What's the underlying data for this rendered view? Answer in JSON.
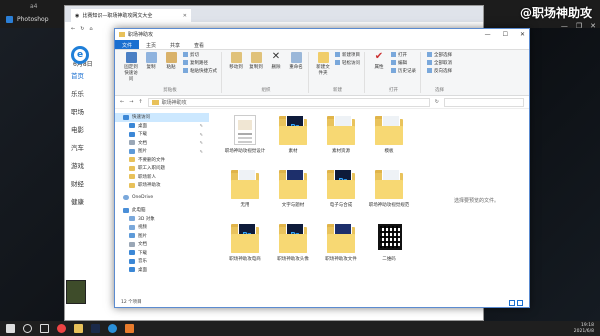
{
  "watermark": "@职场神助攻",
  "photoshop": {
    "tab_label": "Photoshop",
    "top_label": "a4"
  },
  "browser": {
    "tab_title": "比赛知识—职场神助攻网文大全",
    "side_items": [
      "乐乐",
      "职场",
      "电影",
      "汽车",
      "游戏",
      "财经",
      "健康"
    ],
    "home_label": "首页",
    "date": "6月8日"
  },
  "explorer": {
    "title": "职场神助攻",
    "ribbon_tabs": [
      "文件",
      "主页",
      "共享",
      "查看"
    ],
    "ribbon_groups": [
      {
        "name": "剪贴板",
        "buttons": [
          "固定到快速访问",
          "复制",
          "粘贴"
        ],
        "list": [
          "剪切",
          "复制路径",
          "粘贴快捷方式"
        ]
      },
      {
        "name": "组织",
        "buttons": [
          "移动到",
          "复制到",
          "删除",
          "重命名"
        ],
        "list": []
      },
      {
        "name": "新建",
        "buttons": [
          "新建文件夹"
        ],
        "list": [
          "新建项目",
          "轻松访问"
        ]
      },
      {
        "name": "打开",
        "buttons": [
          "属性"
        ],
        "list": [
          "打开",
          "编辑",
          "历史记录"
        ]
      },
      {
        "name": "选择",
        "buttons": [],
        "list": [
          "全部选择",
          "全部取消",
          "反向选择"
        ]
      }
    ],
    "address": "职场神助攻",
    "nav": {
      "quick_access": "快速访问",
      "quick_items": [
        "桌面",
        "下载",
        "文档",
        "图片",
        "不要删的文件",
        "职工入职问题",
        "职场新人",
        "职场神助攻"
      ],
      "onedrive": "OneDrive",
      "this_pc": "此电脑",
      "pc_items": [
        "3D 对象",
        "视频",
        "图片",
        "文档",
        "下载",
        "音乐",
        "桌面"
      ]
    },
    "items": [
      {
        "label": "职场神助攻视觉设计",
        "kind": "doc"
      },
      {
        "label": "素材",
        "kind": "folder-ps"
      },
      {
        "label": "素材资源",
        "kind": "folder-light"
      },
      {
        "label": "模板",
        "kind": "folder-light"
      },
      {
        "label": "无用",
        "kind": "folder-light"
      },
      {
        "label": "文字与题材",
        "kind": "folder-blue"
      },
      {
        "label": "电子与合成",
        "kind": "folder-ps"
      },
      {
        "label": "职场神助攻视觉规范",
        "kind": "folder-light"
      },
      {
        "label": "职场神助攻电商",
        "kind": "folder-ps"
      },
      {
        "label": "职场神助攻头像",
        "kind": "folder-ps"
      },
      {
        "label": "职场神助攻文件",
        "kind": "folder-blue"
      },
      {
        "label": "二维码",
        "kind": "qr"
      }
    ],
    "preview_msg": "选择要预览的文件。",
    "status": "12 个项目"
  },
  "taskbar": {
    "time": "19:18",
    "date": "2021/6/8"
  }
}
